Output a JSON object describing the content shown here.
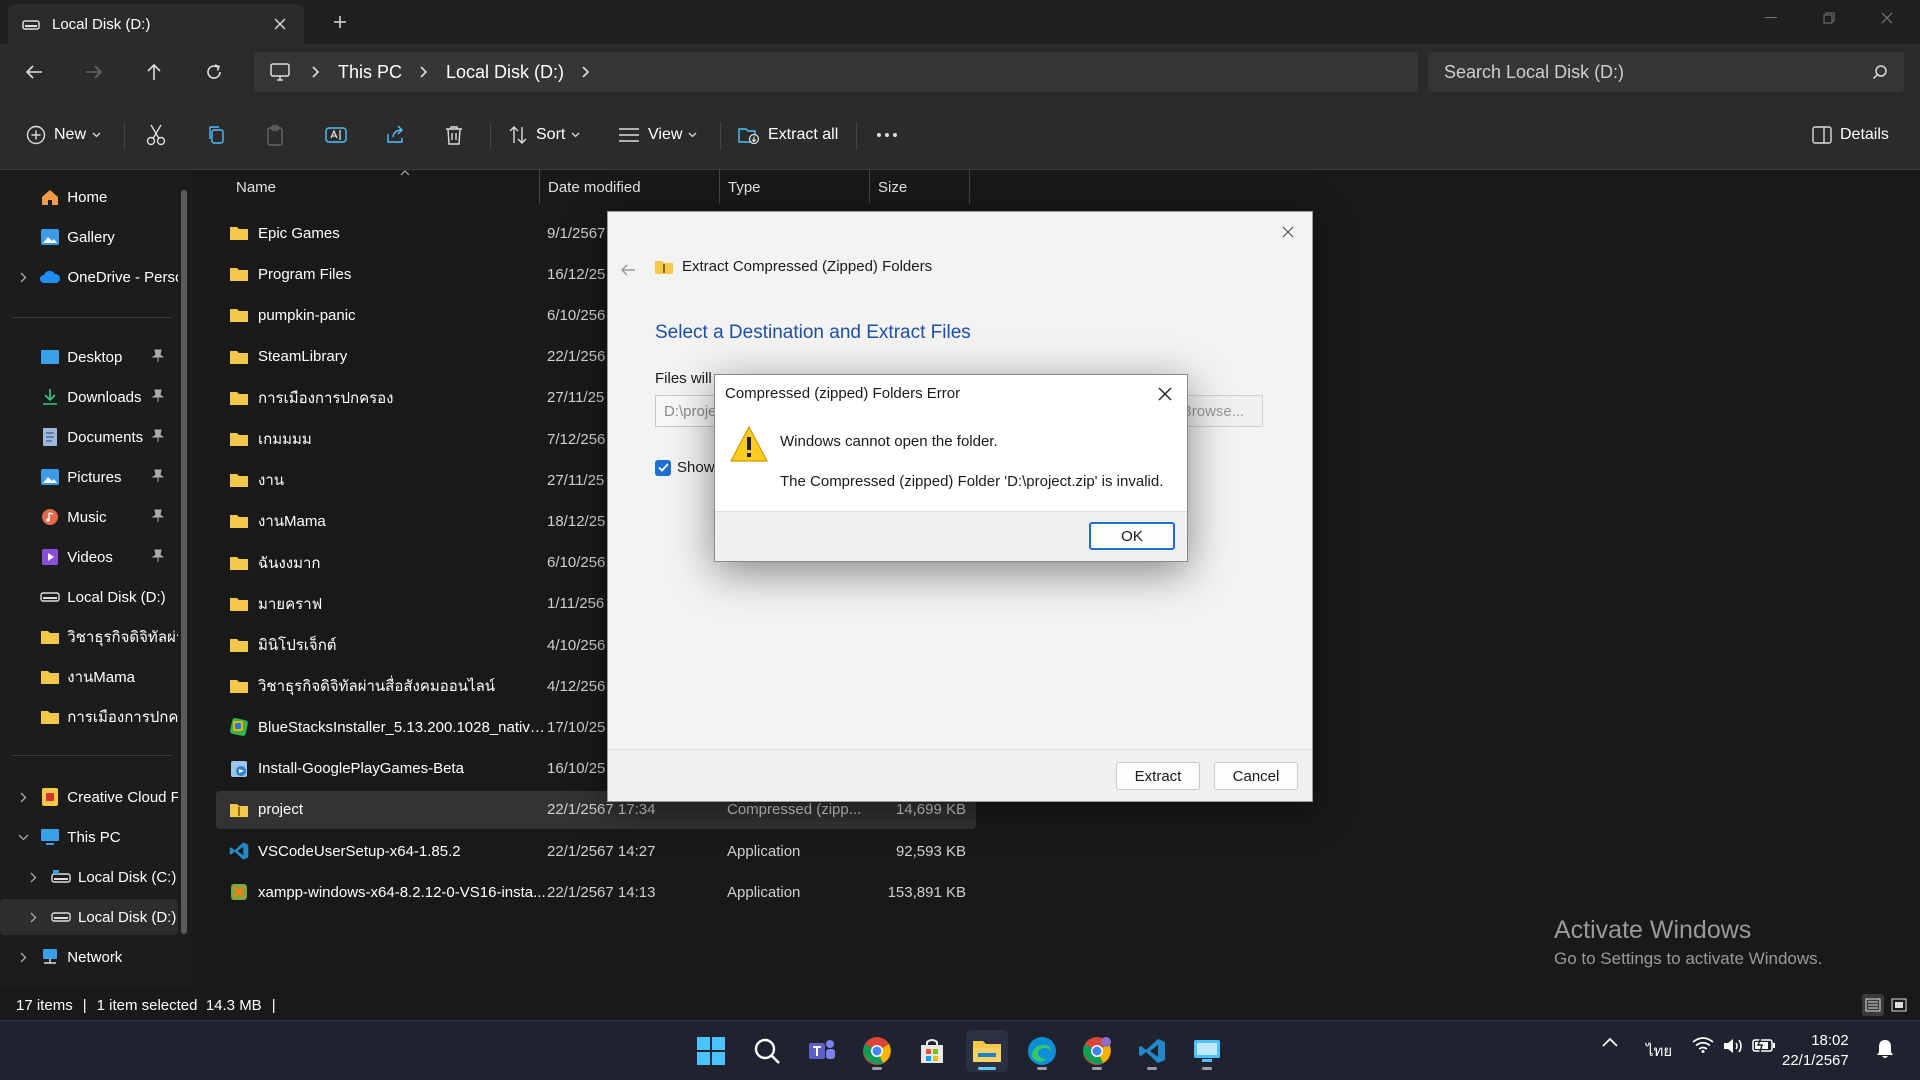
{
  "window": {
    "tab_title": "Local Disk (D:)"
  },
  "address": {
    "crumbs": [
      "This PC",
      "Local Disk (D:)"
    ],
    "search_placeholder": "Search Local Disk (D:)"
  },
  "toolbar": {
    "new_label": "New",
    "sort_label": "Sort",
    "view_label": "View",
    "extract_all_label": "Extract all",
    "details_label": "Details"
  },
  "sidebar": {
    "items": [
      {
        "label": "Home",
        "icon": "home-icon"
      },
      {
        "label": "Gallery",
        "icon": "gallery-icon"
      },
      {
        "label": "OneDrive - Perso",
        "icon": "onedrive-icon"
      },
      {
        "label": "Desktop",
        "icon": "desktop-icon"
      },
      {
        "label": "Downloads",
        "icon": "downloads-icon"
      },
      {
        "label": "Documents",
        "icon": "documents-icon"
      },
      {
        "label": "Pictures",
        "icon": "pictures-icon"
      },
      {
        "label": "Music",
        "icon": "music-icon"
      },
      {
        "label": "Videos",
        "icon": "videos-icon"
      },
      {
        "label": "Local Disk (D:)",
        "icon": "drive-icon"
      },
      {
        "label": "วิชาธุรกิจดิจิทัลผ่าน",
        "icon": "folder-icon"
      },
      {
        "label": "งานMama",
        "icon": "folder-icon"
      },
      {
        "label": "การเมืองการปกครอ",
        "icon": "folder-icon"
      },
      {
        "label": "Creative Cloud F",
        "icon": "creative-cloud-icon"
      },
      {
        "label": "This PC",
        "icon": "this-pc-icon"
      },
      {
        "label": "Local Disk (C:)",
        "icon": "drive-icon"
      },
      {
        "label": "Local Disk (D:)",
        "icon": "drive-icon"
      },
      {
        "label": "Network",
        "icon": "network-icon"
      }
    ]
  },
  "columns": {
    "name": "Name",
    "date": "Date modified",
    "type": "Type",
    "size": "Size"
  },
  "files": [
    {
      "name": "Epic Games",
      "date": "9/1/2567",
      "type": "",
      "size": "",
      "icon": "folder-icon"
    },
    {
      "name": "Program Files",
      "date": "16/12/25",
      "type": "",
      "size": "",
      "icon": "folder-icon"
    },
    {
      "name": "pumpkin-panic",
      "date": "6/10/256",
      "type": "",
      "size": "",
      "icon": "folder-icon"
    },
    {
      "name": "SteamLibrary",
      "date": "22/1/256",
      "type": "",
      "size": "",
      "icon": "folder-icon"
    },
    {
      "name": "การเมืองการปกครอง",
      "date": "27/11/25",
      "type": "",
      "size": "",
      "icon": "folder-icon"
    },
    {
      "name": "เกมมมม",
      "date": "7/12/256",
      "type": "",
      "size": "",
      "icon": "folder-icon"
    },
    {
      "name": "งาน",
      "date": "27/11/25",
      "type": "",
      "size": "",
      "icon": "folder-icon"
    },
    {
      "name": "งานMama",
      "date": "18/12/25",
      "type": "",
      "size": "",
      "icon": "folder-icon"
    },
    {
      "name": "ฉันงงมาก",
      "date": "6/10/256",
      "type": "",
      "size": "",
      "icon": "folder-icon"
    },
    {
      "name": "มายคราฟ",
      "date": "1/11/256",
      "type": "",
      "size": "",
      "icon": "folder-icon"
    },
    {
      "name": "มินิโปรเจ็กต์",
      "date": "4/10/256",
      "type": "",
      "size": "",
      "icon": "folder-icon"
    },
    {
      "name": "วิชาธุรกิจดิจิทัลผ่านสื่อสังคมออนไลน์",
      "date": "4/12/256",
      "type": "",
      "size": "",
      "icon": "folder-icon"
    },
    {
      "name": "BlueStacksInstaller_5.13.200.1028_native_...",
      "date": "17/10/25",
      "type": "",
      "size": "",
      "icon": "bluestacks-icon"
    },
    {
      "name": "Install-GooglePlayGames-Beta",
      "date": "16/10/25",
      "type": "",
      "size": "",
      "icon": "installer-icon"
    },
    {
      "name": "project",
      "date": "22/1/2567 17:34",
      "type": "Compressed (zipp...",
      "size": "14,699 KB",
      "icon": "zip-folder-icon"
    },
    {
      "name": "VSCodeUserSetup-x64-1.85.2",
      "date": "22/1/2567 14:27",
      "type": "Application",
      "size": "92,593 KB",
      "icon": "vscode-icon"
    },
    {
      "name": "xampp-windows-x64-8.2.12-0-VS16-insta...",
      "date": "22/1/2567 14:13",
      "type": "Application",
      "size": "153,891 KB",
      "icon": "xampp-icon"
    }
  ],
  "status": {
    "items": "17 items",
    "selected": "1 item selected  14.3 MB"
  },
  "watermark": {
    "line1": "Activate Windows",
    "line2": "Go to Settings to activate Windows."
  },
  "wizard": {
    "title": "Extract Compressed (Zipped) Folders",
    "heading": "Select a Destination and Extract Files",
    "files_label": "Files will",
    "path_value": "D:\\proje",
    "browse_label": "Browse...",
    "show_label": "Show",
    "extract_label": "Extract",
    "cancel_label": "Cancel"
  },
  "error_dialog": {
    "title": "Compressed (zipped) Folders Error",
    "message1": "Windows cannot open the folder.",
    "message2": "The Compressed (zipped) Folder 'D:\\project.zip' is invalid.",
    "ok_label": "OK"
  },
  "taskbar": {
    "lang": "ไทย",
    "time": "18:02",
    "date": "22/1/2567"
  },
  "colors": {
    "accent": "#60cdff",
    "folder": "#f3c74a",
    "link_blue": "#1e4fa3"
  }
}
